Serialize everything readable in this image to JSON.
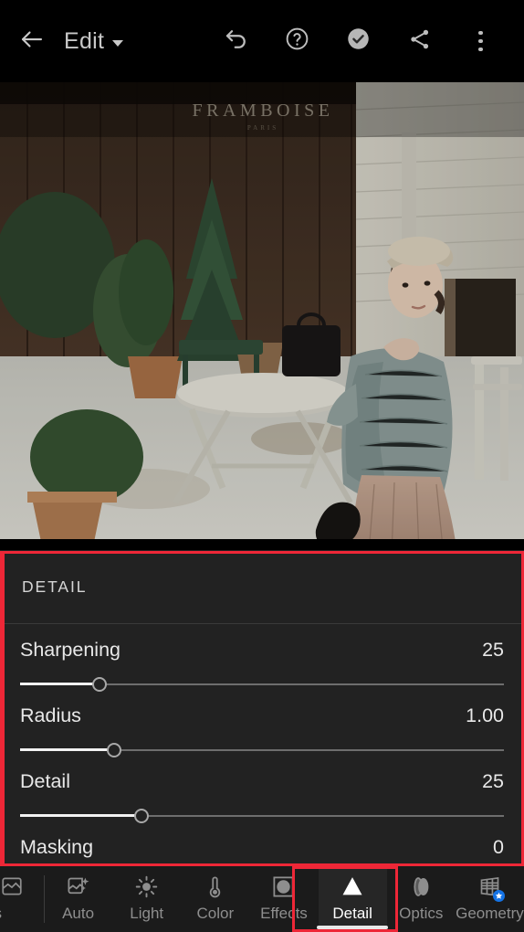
{
  "app": {
    "title": "Edit",
    "title_has_dropdown": true
  },
  "topbar": {
    "back_icon": "arrow-left-icon",
    "title": "Edit",
    "dropdown_icon": "chevron-down-icon",
    "actions": [
      {
        "name": "undo-button",
        "icon": "undo-arrow-icon"
      },
      {
        "name": "help-button",
        "icon": "question-circle-icon"
      },
      {
        "name": "done-button",
        "icon": "check-circle-filled-icon"
      },
      {
        "name": "share-button",
        "icon": "share-nodes-icon"
      },
      {
        "name": "more-button",
        "icon": "three-dots-vertical-icon"
      }
    ]
  },
  "photo": {
    "alt": "Woman in grey knit sweater seated at outdoor cafe terrace",
    "sign_text": "FRAMBOISE",
    "sign_subtext": "PARIS"
  },
  "panel": {
    "header": "DETAIL",
    "sliders": [
      {
        "label": "Sharpening",
        "value": "25",
        "percent": 16.5,
        "clipped": false
      },
      {
        "label": "Radius",
        "value": "1.00",
        "percent": 19.5,
        "clipped": false
      },
      {
        "label": "Detail",
        "value": "25",
        "percent": 25.0,
        "clipped": false
      },
      {
        "label": "Masking",
        "value": "0",
        "percent": 0,
        "clipped": true
      }
    ]
  },
  "toolbar": {
    "items": [
      {
        "label": "es",
        "icon": "presets-icon",
        "active": false,
        "partial": true
      },
      {
        "label": "Auto",
        "icon": "auto-magic-image-icon",
        "active": false,
        "partial": false
      },
      {
        "label": "Light",
        "icon": "sun-icon",
        "active": false,
        "partial": false
      },
      {
        "label": "Color",
        "icon": "thermometer-icon",
        "active": false,
        "partial": false
      },
      {
        "label": "Effects",
        "icon": "vignette-square-icon",
        "active": false,
        "partial": false
      },
      {
        "label": "Detail",
        "icon": "triangle-up-icon",
        "active": true,
        "partial": false
      },
      {
        "label": "Optics",
        "icon": "lens-icon",
        "active": false,
        "partial": false
      },
      {
        "label": "Geometry",
        "icon": "perspective-grid-icon",
        "active": false,
        "partial": false,
        "badge": "star-badge"
      }
    ]
  },
  "annotations": {
    "color": "#ee2737",
    "boxes": [
      {
        "name": "detail-panel-highlight",
        "target": "panel"
      },
      {
        "name": "detail-tab-highlight",
        "target": "toolbar-detail-tab"
      }
    ]
  },
  "colors": {
    "panel_bg": "#222222",
    "toolbar_bg": "#1b1b1b",
    "topbar_bg": "#000000",
    "accent_red": "#ee2737",
    "badge_blue": "#1473e6",
    "text_primary": "#e8e8e8",
    "text_muted": "#8e8e8e"
  }
}
